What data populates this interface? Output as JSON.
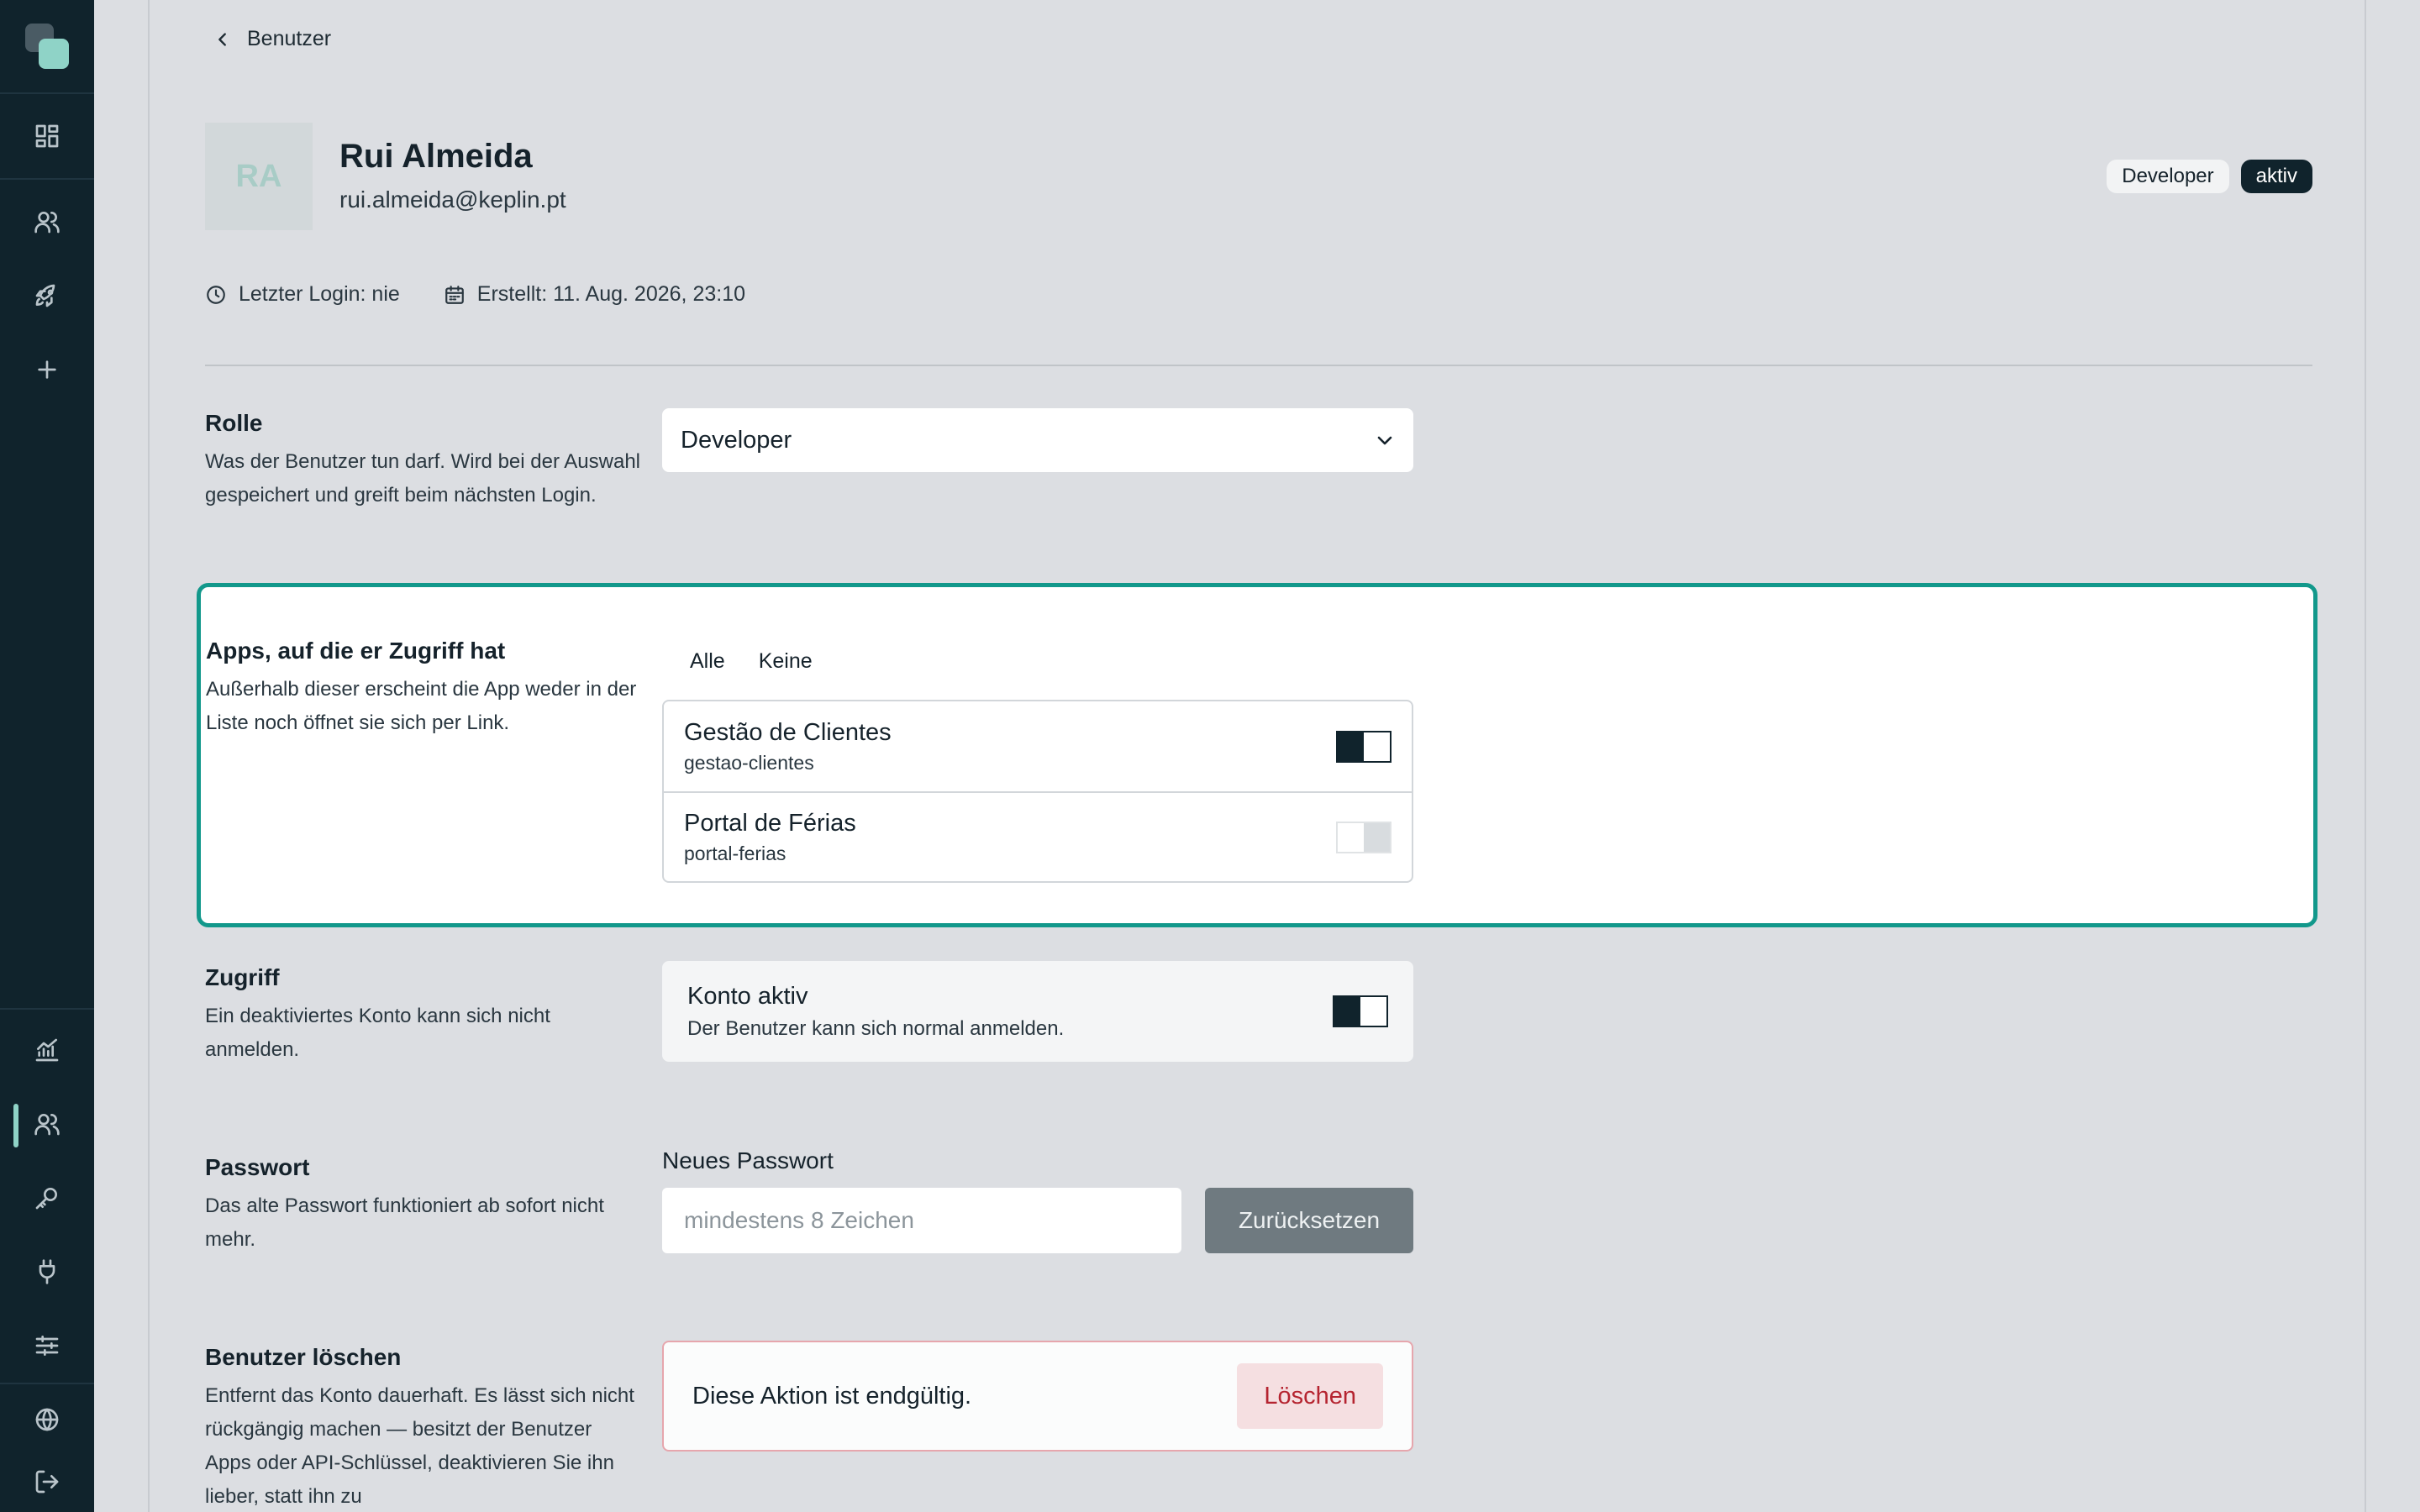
{
  "nav": {
    "top": [
      {
        "name": "dashboard-icon"
      }
    ],
    "main": [
      {
        "name": "users-icon"
      },
      {
        "name": "rocket-icon"
      },
      {
        "name": "plus-icon"
      }
    ],
    "bottom": [
      {
        "name": "chart-icon"
      },
      {
        "name": "users-icon",
        "active": true
      },
      {
        "name": "key-icon"
      },
      {
        "name": "plug-icon"
      },
      {
        "name": "sliders-icon"
      }
    ],
    "footer": [
      {
        "name": "globe-icon"
      },
      {
        "name": "logout-icon"
      }
    ]
  },
  "back": {
    "label": "Benutzer"
  },
  "user": {
    "initials": "RA",
    "name": "Rui Almeida",
    "email": "rui.almeida@keplin.pt",
    "role_badge": "Developer",
    "status_badge": "aktiv",
    "last_login": "Letzter Login: nie",
    "created": "Erstellt: 11. Aug. 2026, 23:10"
  },
  "sections": {
    "role": {
      "title": "Rolle",
      "desc": "Was der Benutzer tun darf. Wird bei der Auswahl gespeichert und greift beim nächsten Login.",
      "selected": "Developer"
    },
    "apps": {
      "title": "Apps, auf die er Zugriff hat",
      "desc": "Außerhalb dieser erscheint die App weder in der Liste noch öffnet sie sich per Link.",
      "all_label": "Alle",
      "none_label": "Keine",
      "items": [
        {
          "name": "Gestão de Clientes",
          "slug": "gestao-clientes",
          "enabled": true
        },
        {
          "name": "Portal de Férias",
          "slug": "portal-ferias",
          "enabled": false
        }
      ]
    },
    "access": {
      "title": "Zugriff",
      "desc": "Ein deaktiviertes Konto kann sich nicht anmelden.",
      "card_title": "Konto aktiv",
      "card_sub": "Der Benutzer kann sich normal anmelden.",
      "enabled": true
    },
    "password": {
      "title": "Passwort",
      "desc": "Das alte Passwort funktioniert ab sofort nicht mehr.",
      "field_label": "Neues Passwort",
      "placeholder": "mindestens 8 Zeichen",
      "button": "Zurücksetzen"
    },
    "delete": {
      "title": "Benutzer löschen",
      "desc": "Entfernt das Konto dauerhaft. Es lässt sich nicht rückgängig machen — besitzt der Benutzer Apps oder API-Schlüssel, deaktivieren Sie ihn lieber, statt ihn zu",
      "card_text": "Diese Aktion ist endgültig.",
      "button": "Löschen"
    }
  },
  "colors": {
    "sidebar": "#10232c",
    "accent": "#12988b",
    "danger": "#b52430"
  }
}
